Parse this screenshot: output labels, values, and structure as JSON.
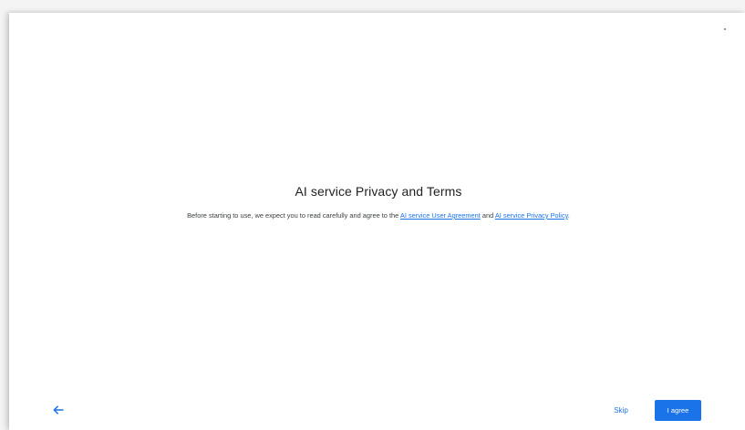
{
  "dialog": {
    "title": "AI service Privacy and Terms",
    "description_prefix": "Before starting to use, we expect you to read carefully and agree to the ",
    "user_agreement_link": "AI service User Agreement",
    "description_and": " and ",
    "privacy_policy_link": "AI service Privacy Policy",
    "description_suffix": "."
  },
  "footer": {
    "back_icon": "arrow-left-icon",
    "skip_label": "Skip",
    "agree_label": "I agree"
  },
  "colors": {
    "accent": "#1a73e8",
    "text_primary": "#202124",
    "text_secondary": "#3c4043",
    "background": "#ffffff"
  }
}
